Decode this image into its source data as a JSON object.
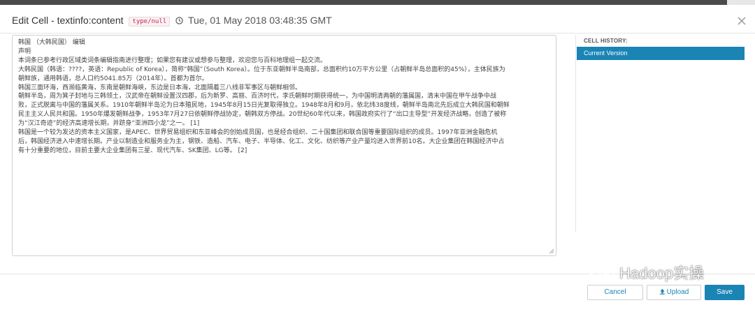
{
  "header": {
    "title": "Edit Cell - textinfo:content",
    "type_badge": "type/null",
    "timestamp": "Tue, 01 May 2018 03:48:35 GMT"
  },
  "editor": {
    "lines": [
      "韩国 （大韩民国） 编辑",
      "声明",
      "本词条已参考行政区域类词条编辑指南进行整理；如果您有建议或想参与整理，欢迎您与百科地理组一起交流。",
      "大韩民国（韩语：????，英语：Republic of Korea），简称“韩国”（South Korea）。位于东亚朝鲜半岛南部，总面积约10万平方公里（占朝鲜半岛总面积的45%），主体民族为",
      "朝鲜族，通用韩语，总人口约5041.85万（2014年）。首都为首尔。",
      "韩国三面环海，西濒临黄海，东南是朝鲜海峡，东边是日本海，北面隔着三八线非军事区与朝鲜相邻。",
      "朝鲜半岛，周为箕子封地与三韩领土，汉武帝在朝鲜设置汉四郡，后为新罗、高丽、百济时代，李氏朝鲜时期获得统一，为中国明清两朝的藩属国，清末中国在甲午战争中战",
      "败，正式脱离与中国的藩属关系。1910年朝鲜半岛沦为日本殖民地，1945年8月15日光复取得独立。1948年8月和9月，依北纬38度线，朝鲜半岛南北先后成立大韩民国和朝鲜",
      "民主主义人民共和国。1950年爆发朝鲜战争，1953年7月27日依朝鲜停战协定，朝韩双方停战。20世纪60年代以来，韩国政府实行了“出口主导型”开发经济战略，创造了被称",
      "为“汉江奇迹”的经济高速增长期，并跻身“亚洲四小龙”之一。 [1]",
      "韩国是一个较为发达的资本主义国家，是APEC、世界贸易组织和东亚峰会的创始成员国，也是经合组织、二十国集团和联合国等重要国际组织的成员。1997年亚洲金融危机",
      "后，韩国经济进入中速增长期。产业以制造业和服务业为主，钢铁、造船、汽车、电子、半导体、化工、文化、纺织等产业产量均进入世界前10名。大企业集团在韩国经济中占",
      "有十分重要的地位，目前主要大企业集团有三星、现代汽车、SK集团、LG等。 [2]"
    ]
  },
  "history": {
    "label": "CELL HISTORY:",
    "items": [
      "Current Version"
    ]
  },
  "buttons": {
    "cancel": "Cancel",
    "upload": "Upload",
    "save": "Save"
  },
  "watermark": {
    "text": "Hadoop实操"
  },
  "colors": {
    "accent": "#1a84b4",
    "badge_text": "#c7254e"
  }
}
